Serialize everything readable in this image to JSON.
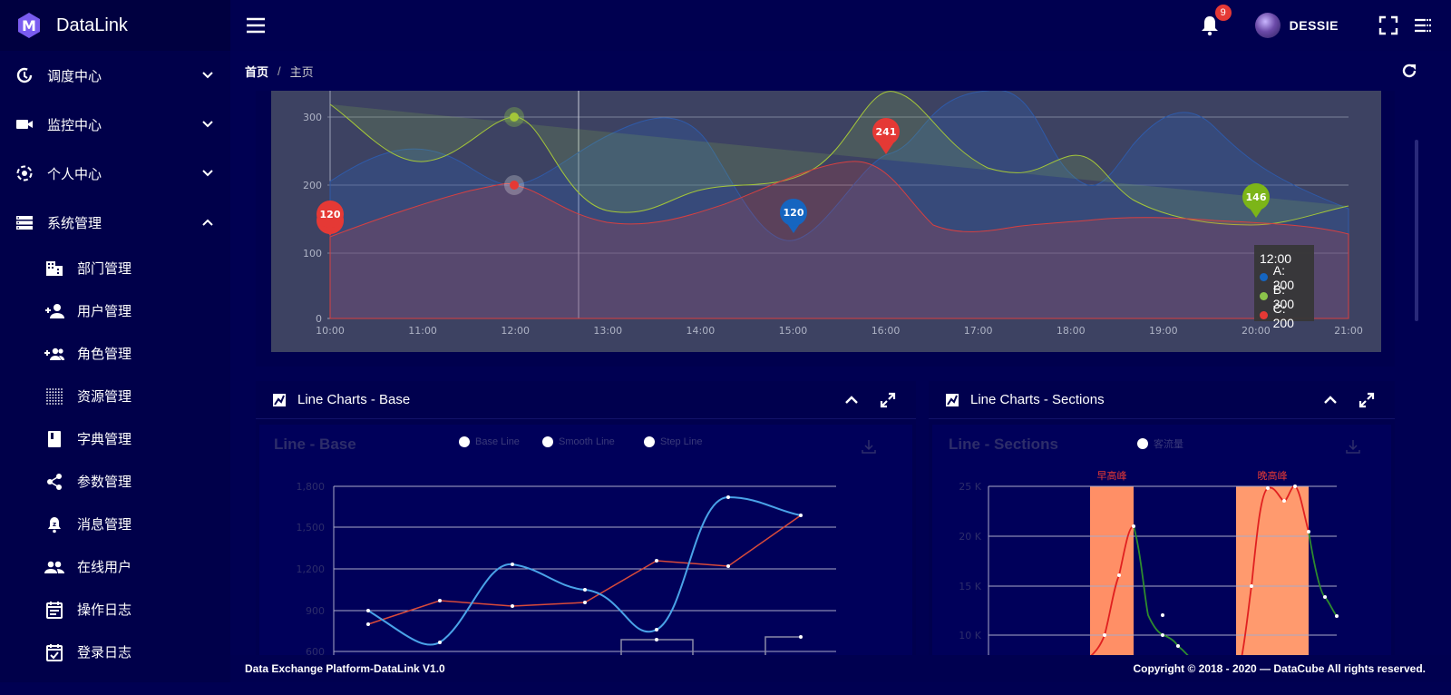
{
  "app": {
    "name": "DataLink"
  },
  "sidebar": {
    "groups": [
      {
        "label": "调度中心",
        "icon": "clock-refresh-icon",
        "expanded": false
      },
      {
        "label": "监控中心",
        "icon": "video-camera-icon",
        "expanded": false
      },
      {
        "label": "个人中心",
        "icon": "target-icon",
        "expanded": false
      },
      {
        "label": "系统管理",
        "icon": "server-icon",
        "expanded": true
      }
    ],
    "sub_items": [
      {
        "label": "部门管理",
        "icon": "building-icon"
      },
      {
        "label": "用户管理",
        "icon": "add-user-icon"
      },
      {
        "label": "角色管理",
        "icon": "add-group-icon"
      },
      {
        "label": "资源管理",
        "icon": "dots-grid-icon"
      },
      {
        "label": "字典管理",
        "icon": "book-icon"
      },
      {
        "label": "参数管理",
        "icon": "share-icon"
      },
      {
        "label": "消息管理",
        "icon": "notification-icon"
      },
      {
        "label": "在线用户",
        "icon": "people-icon"
      },
      {
        "label": "操作日志",
        "icon": "calendar-list-icon"
      },
      {
        "label": "登录日志",
        "icon": "calendar-check-icon"
      }
    ]
  },
  "topbar": {
    "notifications": "9",
    "username": "DESSIE"
  },
  "breadcrumb": {
    "home": "首页",
    "separator": "/",
    "current": "主页"
  },
  "top_chart": {
    "y_ticks": [
      "0",
      "100",
      "200",
      "300"
    ],
    "x_ticks": [
      "10:00",
      "11:00",
      "12:00",
      "13:00",
      "14:00",
      "15:00",
      "16:00",
      "17:00",
      "18:00",
      "19:00",
      "20:00",
      "21:00"
    ],
    "markers": [
      {
        "label": "120",
        "color": "#e53935"
      },
      {
        "label": "120",
        "color": "#1565c0"
      },
      {
        "label": "241",
        "color": "#e53935"
      },
      {
        "label": "146",
        "color": "#7cb518"
      }
    ],
    "tooltip": {
      "time": "12:00",
      "rows": [
        {
          "text": "A: 200",
          "color": "#1565c0"
        },
        {
          "text": "B: 300",
          "color": "#8bc34a"
        },
        {
          "text": "C: 200",
          "color": "#e53935"
        }
      ]
    }
  },
  "card_base": {
    "title": "Line Charts - Base",
    "chart_title": "Line - Base",
    "legend": [
      "Base Line",
      "Smooth Line",
      "Step Line"
    ],
    "y_ticks": [
      "1,800",
      "1,500",
      "1,200",
      "900",
      "600"
    ]
  },
  "card_sections": {
    "title": "Line Charts - Sections",
    "chart_title": "Line - Sections",
    "legend": [
      "客流量"
    ],
    "band_labels": [
      "早高峰",
      "晚高峰"
    ],
    "y_ticks": [
      "25 K",
      "20 K",
      "15 K",
      "10 K"
    ]
  },
  "footer": {
    "left": "Data Exchange Platform-DataLink V1.0",
    "right_prefix": "Copyright © 2018 - 2020 — ",
    "right_brand": "DataCube",
    "right_suffix": " All rights reserved."
  },
  "colors": {
    "accent_red": "#e53935",
    "accent_blue": "#1565c0",
    "accent_green": "#8bc34a",
    "sidebar_bg": "#00004a"
  }
}
